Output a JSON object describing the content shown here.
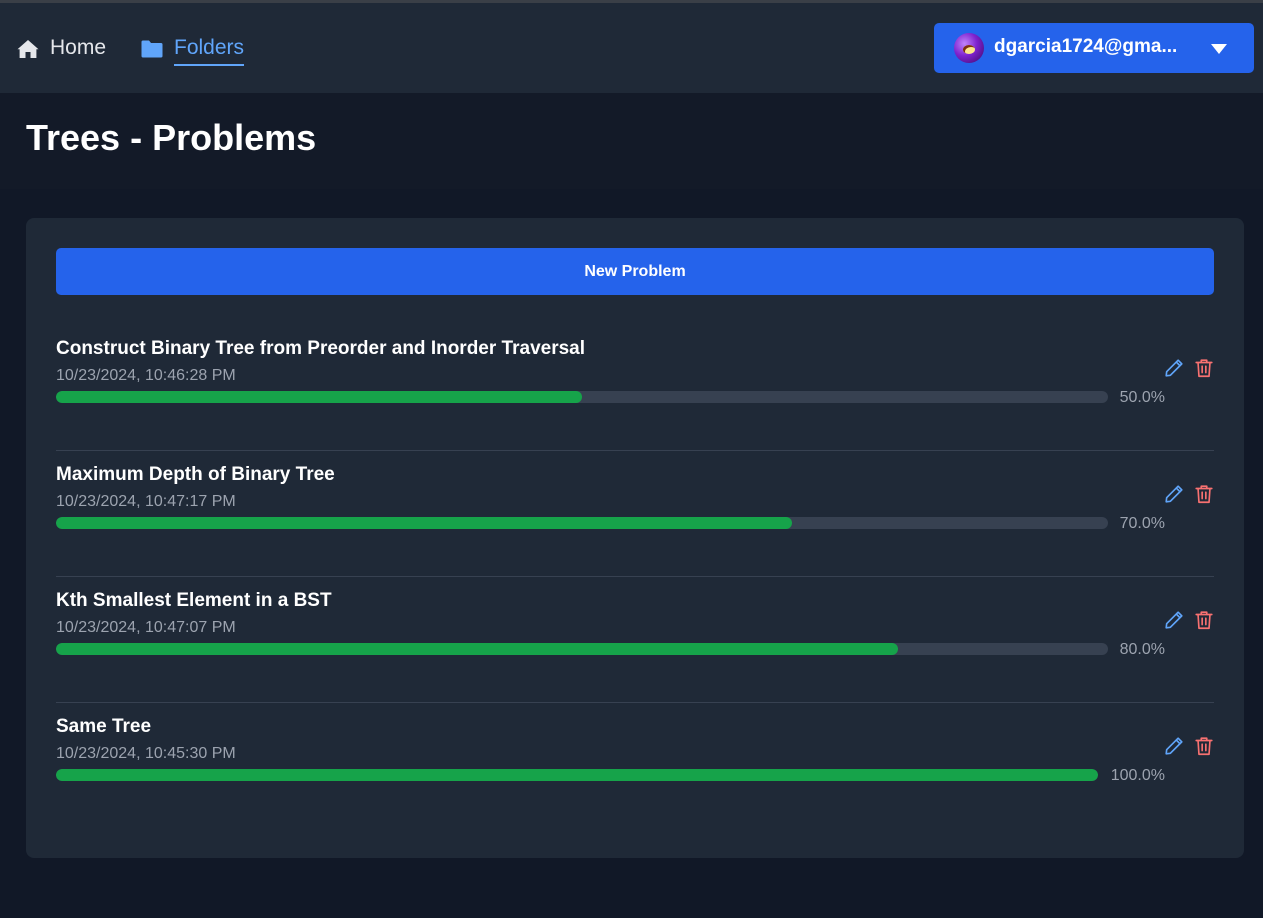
{
  "nav": {
    "home_label": "Home",
    "folders_label": "Folders",
    "user_email": "dgarcia1724@gma..."
  },
  "page": {
    "title": "Trees - Problems"
  },
  "actions": {
    "new_problem_label": "New Problem"
  },
  "colors": {
    "accent": "#2563eb",
    "active_link": "#60a5fa",
    "progress": "#16a34a",
    "delete": "#f87171"
  },
  "icons": {
    "home": "home-icon",
    "folders": "folder-icon",
    "menu": "chevron-down-icon",
    "edit": "pencil-icon",
    "delete": "trash-icon"
  },
  "problems": [
    {
      "title": "Construct Binary Tree from Preorder and Inorder Traversal",
      "date": "10/23/2024, 10:46:28 PM",
      "progress": 50.0,
      "progress_label": "50.0%"
    },
    {
      "title": "Maximum Depth of Binary Tree",
      "date": "10/23/2024, 10:47:17 PM",
      "progress": 70.0,
      "progress_label": "70.0%"
    },
    {
      "title": "Kth Smallest Element in a BST",
      "date": "10/23/2024, 10:47:07 PM",
      "progress": 80.0,
      "progress_label": "80.0%"
    },
    {
      "title": "Same Tree",
      "date": "10/23/2024, 10:45:30 PM",
      "progress": 100.0,
      "progress_label": "100.0%"
    }
  ]
}
